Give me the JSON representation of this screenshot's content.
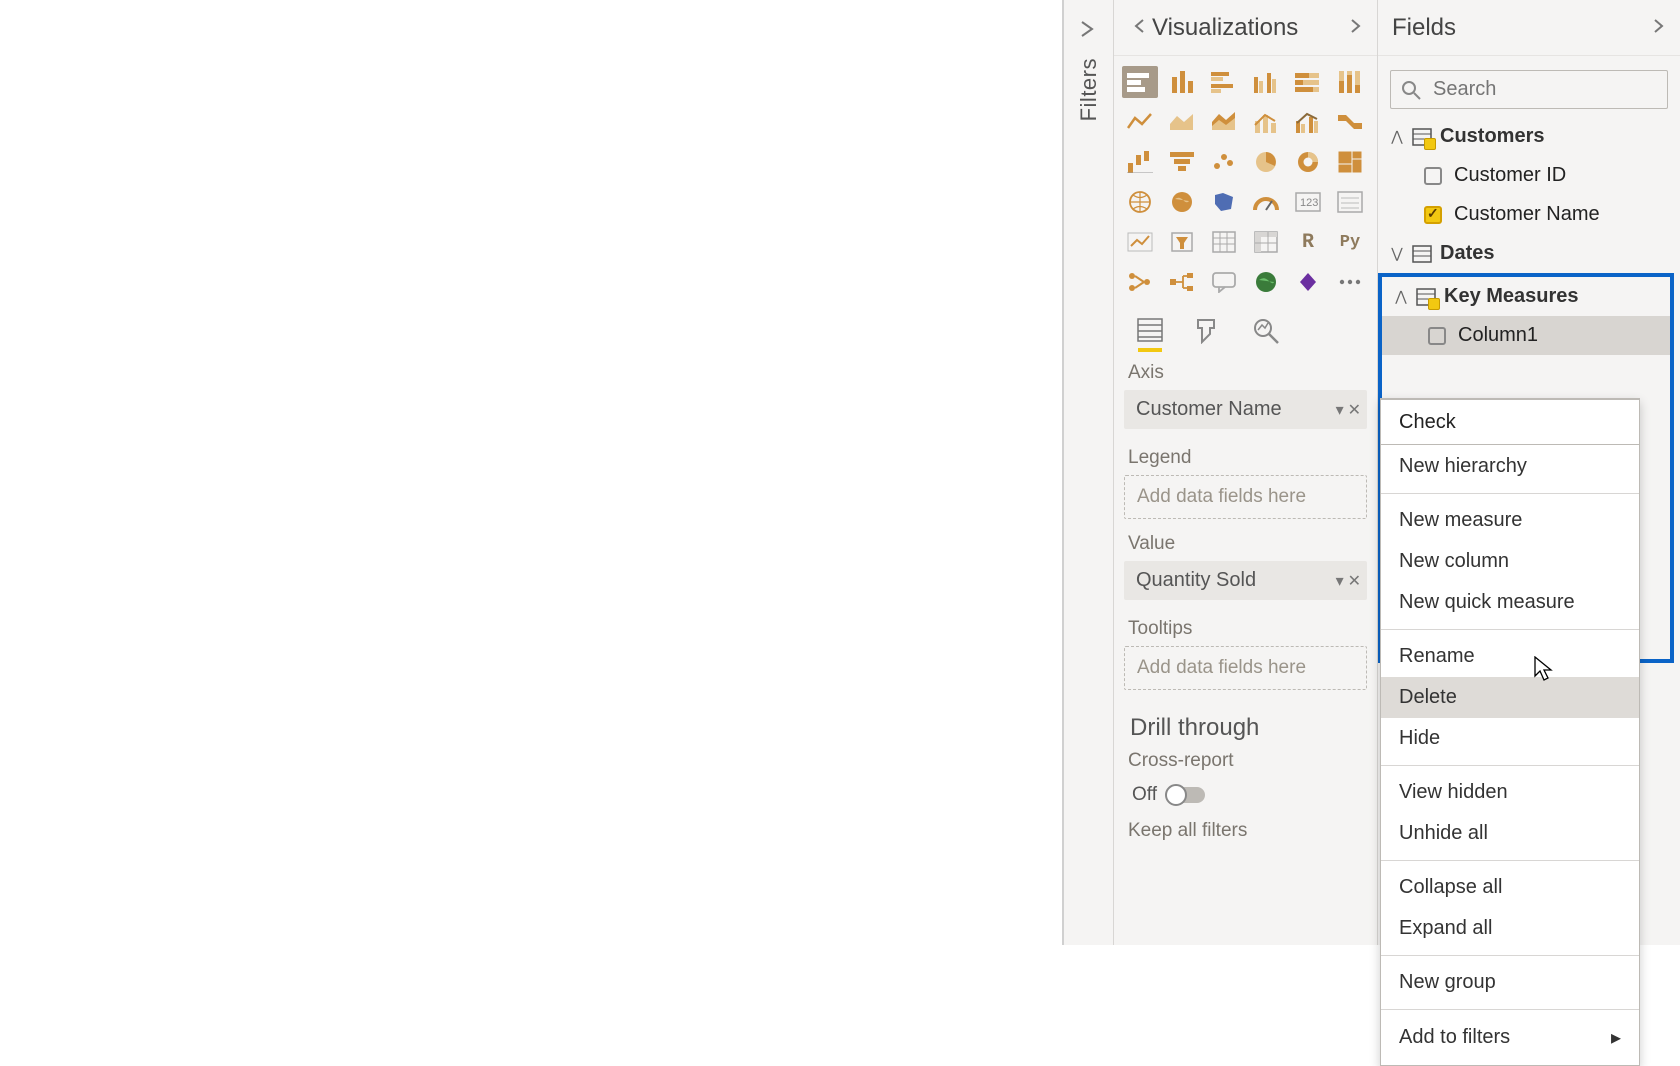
{
  "panes": {
    "filters": "Filters",
    "visualizations": "Visualizations",
    "fields": "Fields"
  },
  "search": {
    "placeholder": "Search"
  },
  "viz": {
    "modes": {
      "fields": "fields",
      "format": "format",
      "analytics": "analytics"
    },
    "sections": {
      "axis": {
        "label": "Axis",
        "pill": "Customer Name"
      },
      "legend": {
        "label": "Legend",
        "placeholder": "Add data fields here"
      },
      "value": {
        "label": "Value",
        "pill": "Quantity Sold"
      },
      "tooltips": {
        "label": "Tooltips",
        "placeholder": "Add data fields here"
      }
    },
    "drill": {
      "title": "Drill through",
      "cross": "Cross-report",
      "off": "Off",
      "keep": "Keep all filters"
    }
  },
  "fields": {
    "tables": {
      "customers": {
        "name": "Customers",
        "cols": {
          "id": "Customer ID",
          "name": "Customer Name"
        }
      },
      "dates": {
        "name": "Dates"
      },
      "keymeasures": {
        "name": "Key Measures",
        "cols": {
          "c1": "Column1"
        }
      }
    }
  },
  "ctx": {
    "check": "Check",
    "newh": "New hierarchy",
    "newm": "New measure",
    "newc": "New column",
    "newq": "New quick measure",
    "ren": "Rename",
    "del": "Delete",
    "hide": "Hide",
    "viewh": "View hidden",
    "unh": "Unhide all",
    "col": "Collapse all",
    "exp": "Expand all",
    "ng": "New group",
    "atf": "Add to filters"
  }
}
